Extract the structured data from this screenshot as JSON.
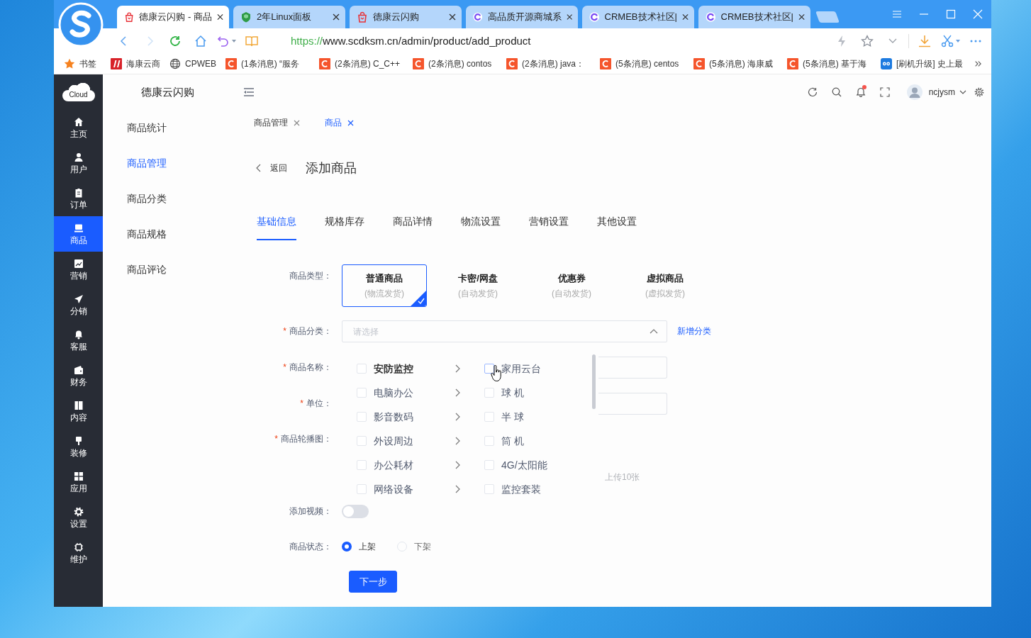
{
  "browser": {
    "tabs": [
      {
        "title": "德康云闪购 - 商品",
        "selected": true
      },
      {
        "title": "2年Linux面板",
        "selected": false
      },
      {
        "title": "德康云闪购",
        "selected": false
      },
      {
        "title": "高品质开源商城系",
        "selected": false
      },
      {
        "title": "CRMEB技术社区|",
        "selected": false
      },
      {
        "title": "CRMEB技术社区|",
        "selected": false
      }
    ],
    "nav": {
      "back_disabled": false,
      "forward_disabled": true
    },
    "url": {
      "scheme": "https://",
      "path": "www.scdksm.cn/admin/product/add_product"
    },
    "bookmarks": [
      {
        "label": "书签"
      },
      {
        "label": "海康云商"
      },
      {
        "label": "CPWEB"
      },
      {
        "label": "(1条消息) “服务"
      },
      {
        "label": "(2条消息) C_C++"
      },
      {
        "label": "(2条消息) contos"
      },
      {
        "label": "(2条消息) java："
      },
      {
        "label": "(5条消息) centos"
      },
      {
        "label": "(5条消息) 海康威"
      },
      {
        "label": "(5条消息) 基于海"
      },
      {
        "label": "[刷机升级] 史上最"
      }
    ]
  },
  "app": {
    "logo": "Cloud",
    "sidebar": [
      {
        "label": "主页",
        "selected": false
      },
      {
        "label": "用户",
        "selected": false
      },
      {
        "label": "订单",
        "selected": false
      },
      {
        "label": "商品",
        "selected": true
      },
      {
        "label": "营销",
        "selected": false
      },
      {
        "label": "分销",
        "selected": false
      },
      {
        "label": "客服",
        "selected": false
      },
      {
        "label": "财务",
        "selected": false
      },
      {
        "label": "内容",
        "selected": false
      },
      {
        "label": "装修",
        "selected": false
      },
      {
        "label": "应用",
        "selected": false
      },
      {
        "label": "设置",
        "selected": false
      },
      {
        "label": "维护",
        "selected": false
      }
    ],
    "submenu": {
      "title": "德康云闪购",
      "items": [
        {
          "label": "商品统计",
          "selected": false
        },
        {
          "label": "商品管理",
          "selected": true
        },
        {
          "label": "商品分类",
          "selected": false
        },
        {
          "label": "商品规格",
          "selected": false
        },
        {
          "label": "商品评论",
          "selected": false
        }
      ]
    },
    "header": {
      "notifications_unread": true,
      "user": "ncjysm"
    },
    "tags": [
      {
        "label": "商品管理",
        "selected": false
      },
      {
        "label": "商品",
        "selected": true
      }
    ],
    "page": {
      "back": "返回",
      "title": "添加商品"
    },
    "tabs": [
      {
        "label": "基础信息",
        "selected": true
      },
      {
        "label": "规格库存",
        "selected": false
      },
      {
        "label": "商品详情",
        "selected": false
      },
      {
        "label": "物流设置",
        "selected": false
      },
      {
        "label": "营销设置",
        "selected": false
      },
      {
        "label": "其他设置",
        "selected": false
      }
    ],
    "form": {
      "product_type": {
        "label": "商品类型：",
        "options": [
          {
            "title": "普通商品",
            "subtitle": "(物流发货)",
            "selected": true
          },
          {
            "title": "卡密/网盘",
            "subtitle": "(自动发货)",
            "selected": false
          },
          {
            "title": "优惠券",
            "subtitle": "(自动发货)",
            "selected": false
          },
          {
            "title": "虚拟商品",
            "subtitle": "(虚拟发货)",
            "selected": false
          }
        ]
      },
      "category": {
        "required_mark": "*",
        "label": "商品分类：",
        "placeholder": "请选择",
        "expanded": true,
        "add_link": "新增分类",
        "cascader": {
          "columns": [
            [
              {
                "label": "安防监控",
                "checked": false,
                "expanded": true
              },
              {
                "label": "电脑办公",
                "checked": false,
                "expanded": false
              },
              {
                "label": "影音数码",
                "checked": false,
                "expanded": false
              },
              {
                "label": "外设周边",
                "checked": false,
                "expanded": false
              },
              {
                "label": "办公耗材",
                "checked": false,
                "expanded": false
              },
              {
                "label": "网络设备",
                "checked": false,
                "expanded": false
              }
            ],
            [
              {
                "label": "家用云台",
                "checked": false,
                "hovered": true
              },
              {
                "label": "球 机",
                "checked": false,
                "hovered": false
              },
              {
                "label": "半 球",
                "checked": false,
                "hovered": false
              },
              {
                "label": "筒 机",
                "checked": false,
                "hovered": false
              },
              {
                "label": "4G/太阳能",
                "checked": false,
                "hovered": false
              },
              {
                "label": "监控套装",
                "checked": false,
                "hovered": false
              }
            ]
          ]
        }
      },
      "name": {
        "required_mark": "*",
        "label": "商品名称："
      },
      "unit": {
        "required_mark": "*",
        "label": "单位："
      },
      "images": {
        "required_mark": "*",
        "label": "商品轮播图：",
        "hint": "上传10张"
      },
      "video": {
        "label": "添加视频：",
        "on": false
      },
      "status": {
        "label": "商品状态：",
        "options": [
          {
            "label": "上架",
            "selected": true
          },
          {
            "label": "下架",
            "selected": false
          }
        ]
      },
      "next_button": "下一步"
    }
  }
}
